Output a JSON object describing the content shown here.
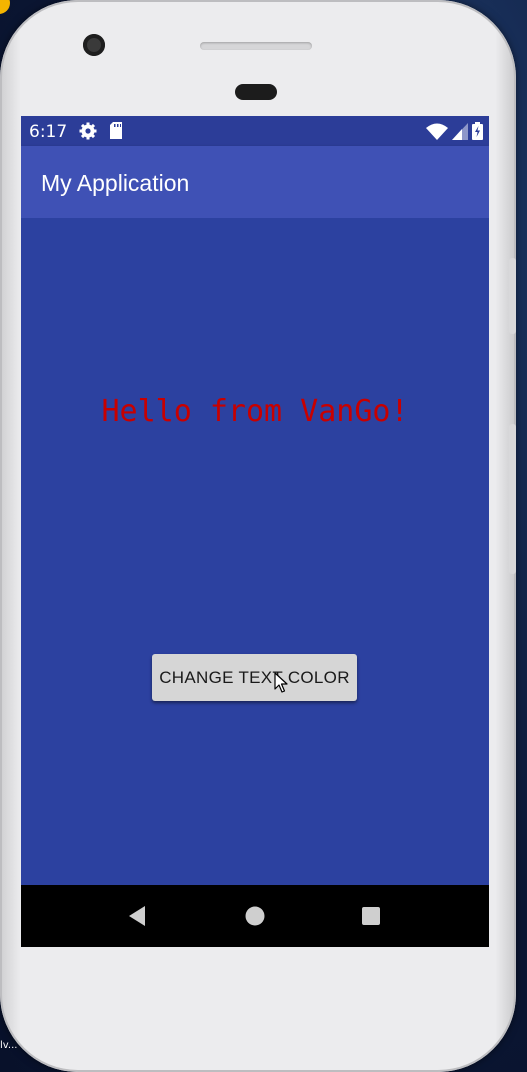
{
  "status_bar": {
    "time": "6:17",
    "left_icons": [
      "gear-icon",
      "sd-card-icon"
    ],
    "right_icons": [
      "wifi-icon",
      "signal-icon",
      "battery-icon"
    ]
  },
  "app_bar": {
    "title": "My Application"
  },
  "main": {
    "hello_text": "Hello from VanGo!",
    "hello_color": "#c80000",
    "button_label": "CHANGE TEXT COLOR",
    "background_color": "#2c41a0"
  },
  "nav_bar": {
    "buttons": [
      "back-icon",
      "home-icon",
      "recents-icon"
    ]
  },
  "colors": {
    "primary": "#3f51b5",
    "primary_dark": "#2c3d98"
  },
  "desktop": {
    "partial_text": "lv..."
  }
}
